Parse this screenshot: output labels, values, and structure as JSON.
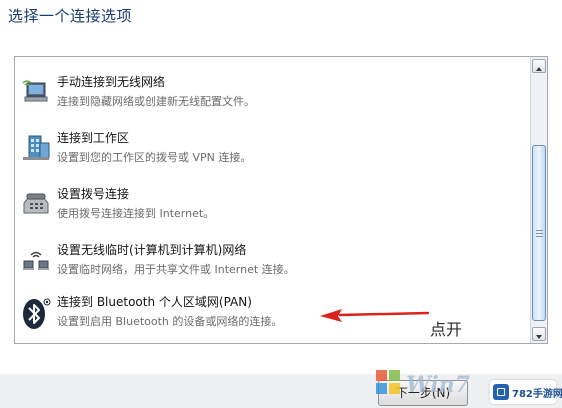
{
  "window": {
    "heading": "选择一个连接选项"
  },
  "options": [
    {
      "title": "手动连接到无线网络",
      "description": "连接到隐藏网络或创建新无线配置文件。",
      "icon": "wireless-computer-icon"
    },
    {
      "title": "连接到工作区",
      "description": "设置到您的工作区的拨号或 VPN 连接。",
      "icon": "workplace-icon"
    },
    {
      "title": "设置拨号连接",
      "description": "使用拨号连接连接到 Internet。",
      "icon": "dialup-phone-icon"
    },
    {
      "title": "设置无线临时(计算机到计算机)网络",
      "description": "设置临时网络，用于共享文件或 Internet 连接。",
      "icon": "adhoc-network-icon"
    },
    {
      "title": "连接到 Bluetooth 个人区域网(PAN)",
      "description": "设置到启用 Bluetooth 的设备或网络的连接。",
      "icon": "bluetooth-icon"
    }
  ],
  "annotation": {
    "text": "点开",
    "color": "#d9231f"
  },
  "footer": {
    "next_label": "下一步(N)"
  },
  "watermarks": {
    "win7": "Win7",
    "site": "782手游网"
  },
  "colors": {
    "heading": "#1a3b6e",
    "scroll_thumb": "#cfe3f7",
    "arrow": "#d9231f"
  }
}
